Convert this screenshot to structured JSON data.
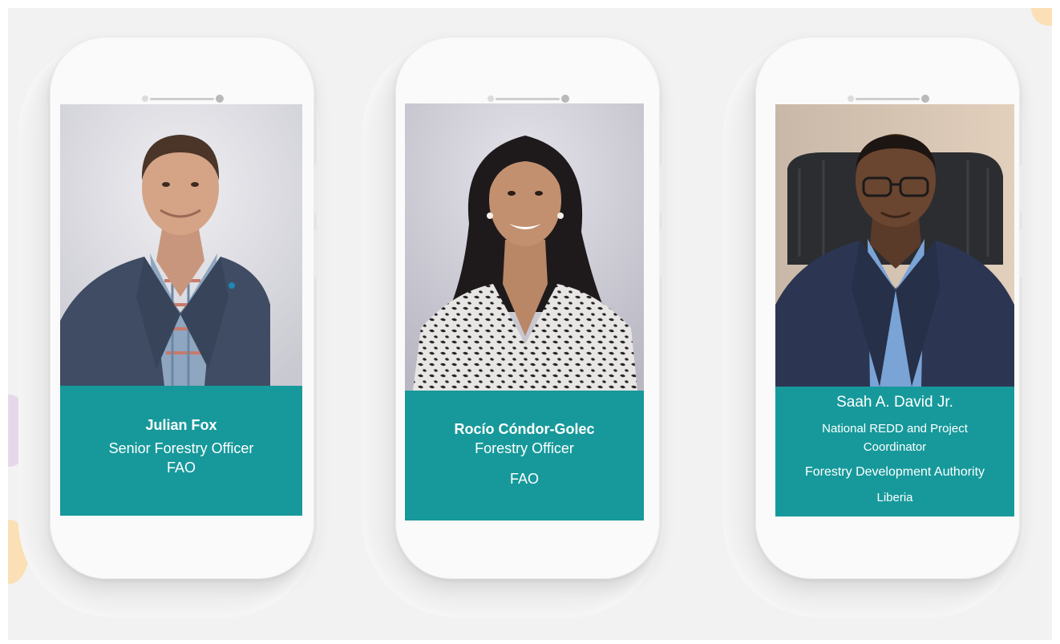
{
  "profiles": [
    {
      "name": "Julian Fox",
      "title": "Senior Forestry Officer",
      "organization": "FAO"
    },
    {
      "name": "Rocío Cóndor-Golec",
      "title": "Forestry Officer",
      "organization": "FAO"
    },
    {
      "name": "Saah A. David Jr.",
      "title_line1": "National REDD and Project",
      "title_line2": "Coordinator",
      "organization": "Forestry Development Authority",
      "country": "Liberia"
    }
  ],
  "colors": {
    "caption_teal": "#17999b",
    "background": "#f2f2f2"
  }
}
